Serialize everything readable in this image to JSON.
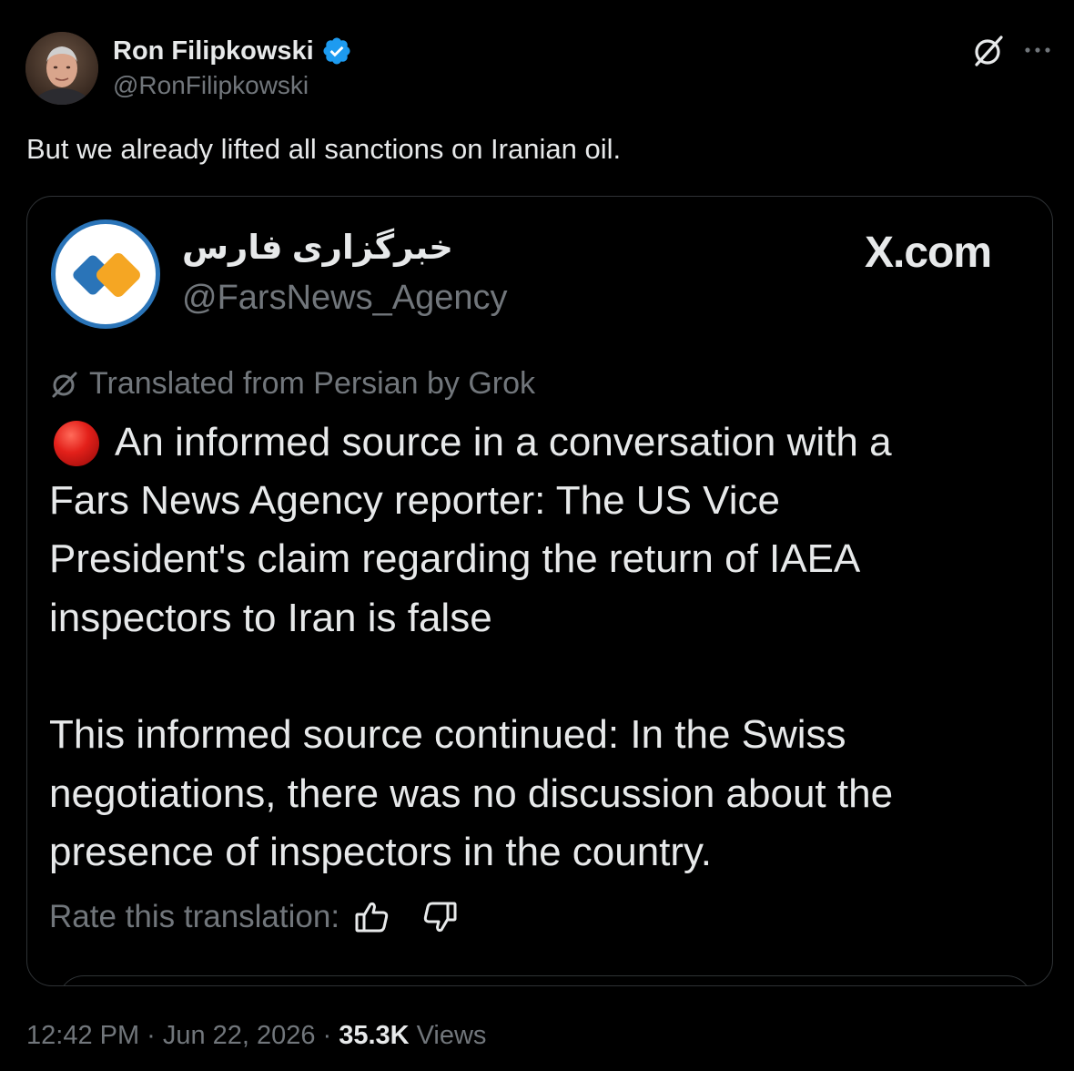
{
  "tweet": {
    "author": {
      "name": "Ron Filipkowski",
      "handle": "@RonFilipkowski",
      "verified": true,
      "verified_color": "#1d9bf0",
      "avatar_icon": "avatar-photo"
    },
    "text": "But we already lifted all sanctions on Iranian oil.",
    "header_icons": {
      "grok": "grok-icon",
      "more": "more-icon"
    },
    "meta": {
      "time": "12:42 PM",
      "separator": "·",
      "date": "Jun 22, 2026",
      "views_count": "35.3K",
      "views_label": "Views"
    }
  },
  "quote": {
    "name": "خبرگزاری فارس",
    "handle": "@FarsNews_Agency",
    "logo_icon": "fars-news-logo",
    "logo_colors": [
      "#2a74b8",
      "#f5a623"
    ],
    "site_label": "X.com",
    "translated_label": "Translated from Persian by Grok",
    "lead_emoji": "red-circle-icon",
    "paragraphs": [
      [
        "An informed source in a conversation with a",
        "Fars News Agency reporter: The US Vice",
        "President's claim regarding the return of IAEA",
        "inspectors to Iran is false"
      ],
      [
        "This informed source continued: In the Swiss",
        "negotiations, there was no discussion about the",
        "presence of inspectors in the country."
      ]
    ],
    "rate_label": "Rate this translation:",
    "rate_icons": [
      "thumbs-up-icon",
      "thumbs-down-icon"
    ]
  }
}
